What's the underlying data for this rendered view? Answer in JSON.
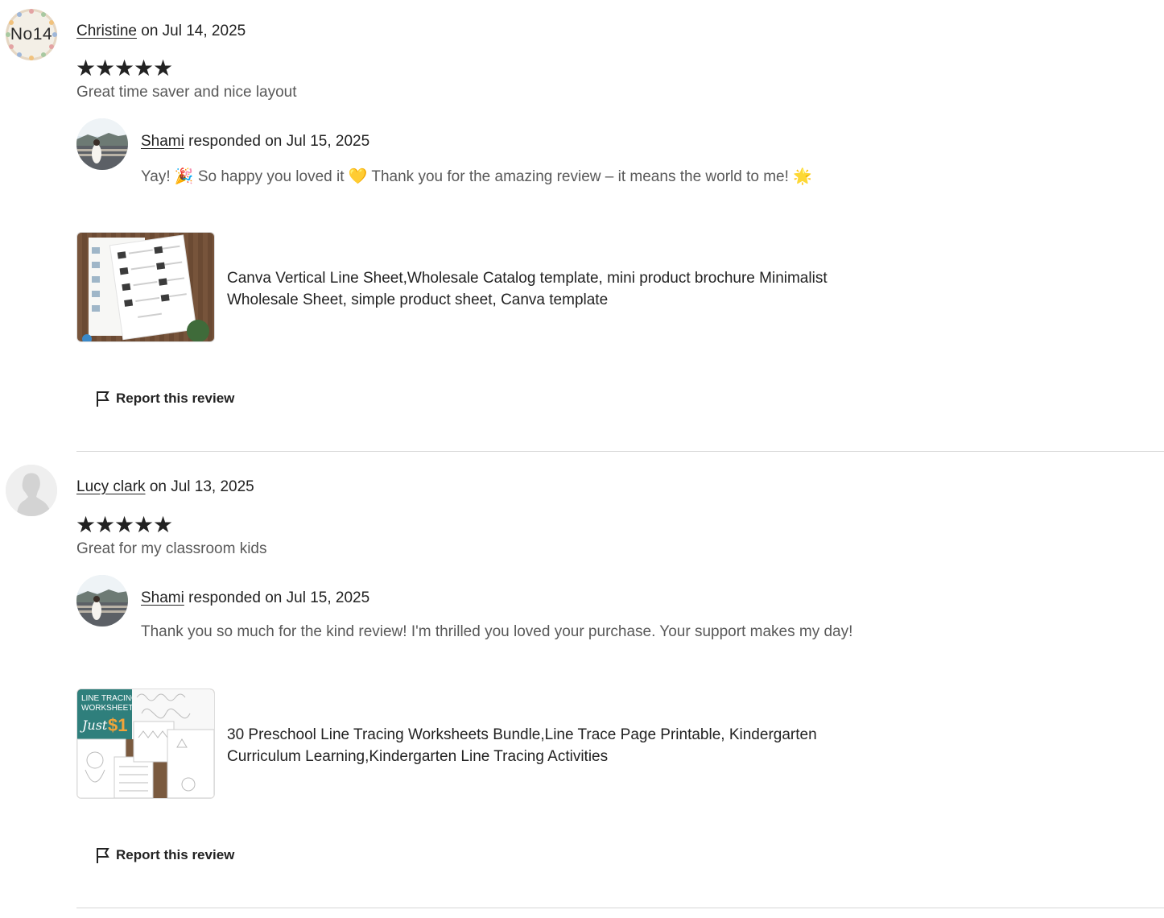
{
  "reviews": [
    {
      "reviewer": "Christine",
      "date_text": "on Jul 14, 2025",
      "avatar_text": "No14",
      "rating": 5,
      "stars": "★★★★★",
      "text": "Great time saver and nice layout",
      "response": {
        "seller": "Shami",
        "date_text": "responded on Jul 15, 2025",
        "text": "Yay! 🎉 So happy you loved it 💛 Thank you for the amazing review – it means the world to me! 🌟"
      },
      "product": {
        "title": "Canva Vertical Line Sheet,Wholesale Catalog template, mini product brochure Minimalist Wholesale Sheet, simple product sheet, Canva template",
        "thumb_icon": "line-sheet-thumbnail"
      },
      "report_label": "Report this review"
    },
    {
      "reviewer": "Lucy clark",
      "date_text": "on Jul 13, 2025",
      "avatar_text": "",
      "rating": 5,
      "stars": "★★★★★",
      "text": "Great for my classroom kids",
      "response": {
        "seller": "Shami",
        "date_text": "responded on Jul 15, 2025",
        "text": "Thank you so much for the kind review! I'm thrilled you loved your purchase. Your support makes my day!"
      },
      "product": {
        "title": "30 Preschool Line Tracing Worksheets Bundle,Line Trace Page Printable, Kindergarten Curriculum Learning,Kindergarten Line Tracing Activities",
        "thumb_icon": "line-tracing-thumbnail",
        "thumb_text": [
          "LINE TRACING",
          "WORKSHEETS",
          "Just",
          "$1"
        ]
      },
      "report_label": "Report this review"
    }
  ],
  "colors": {
    "text": "#222222",
    "muted": "#595959",
    "divider": "#d6d6d6"
  }
}
